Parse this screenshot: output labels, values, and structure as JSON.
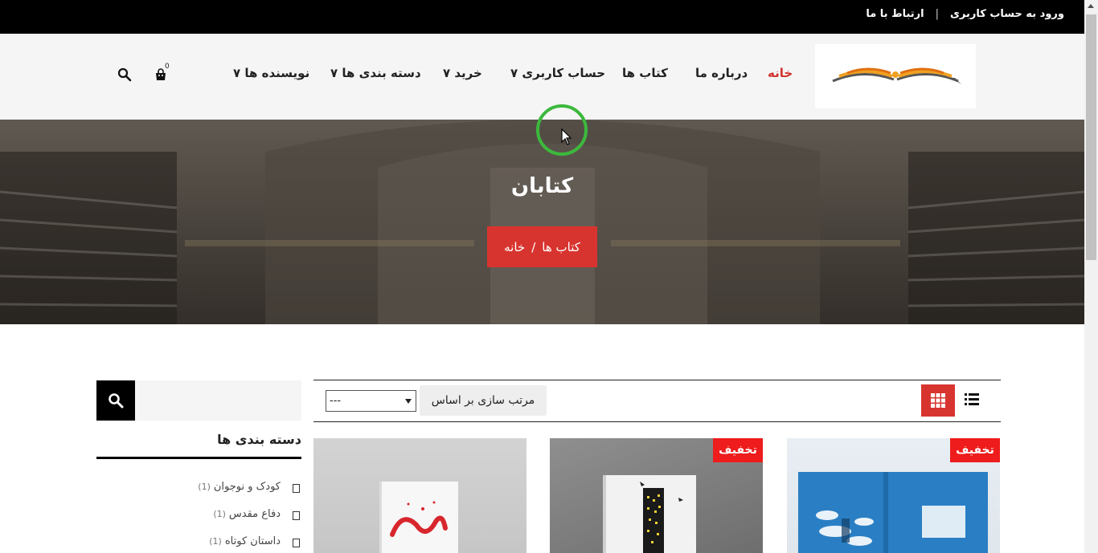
{
  "topbar": {
    "login": "ورود به حساب کاربری",
    "separator": "|",
    "contact": "ارتباط با ما"
  },
  "nav": {
    "home": "خانه",
    "about": "درباره ما",
    "books": "کتاب ها",
    "account": "حساب کاربری ۷",
    "purchase": "خرید ۷",
    "categories": "دسته بندی ها ۷",
    "authors": "نویسنده ها ۷"
  },
  "cart": {
    "count": "0"
  },
  "hero": {
    "title": "کتابان",
    "breadcrumb_home": "خانه",
    "breadcrumb_sep": "/",
    "breadcrumb_current": "کتاب ها"
  },
  "sidebar": {
    "title": "دسته بندی ها",
    "categories": [
      {
        "label": "کودک و نوجوان",
        "count": "(1)"
      },
      {
        "label": "دفاع مقدس",
        "count": "(1)"
      },
      {
        "label": "داستان کوتاه",
        "count": "(1)"
      }
    ]
  },
  "toolbar": {
    "sort_label": "مرتب سازی بر اساس",
    "sort_value": "---"
  },
  "products": [
    {
      "badge": "تخفیف"
    },
    {
      "badge": "تخفیف"
    },
    {
      "badge": ""
    }
  ],
  "colors": {
    "accent": "#d8342f",
    "badge": "#ee1c1c",
    "topbar": "#000000",
    "header_bg": "#f5f5f5"
  }
}
